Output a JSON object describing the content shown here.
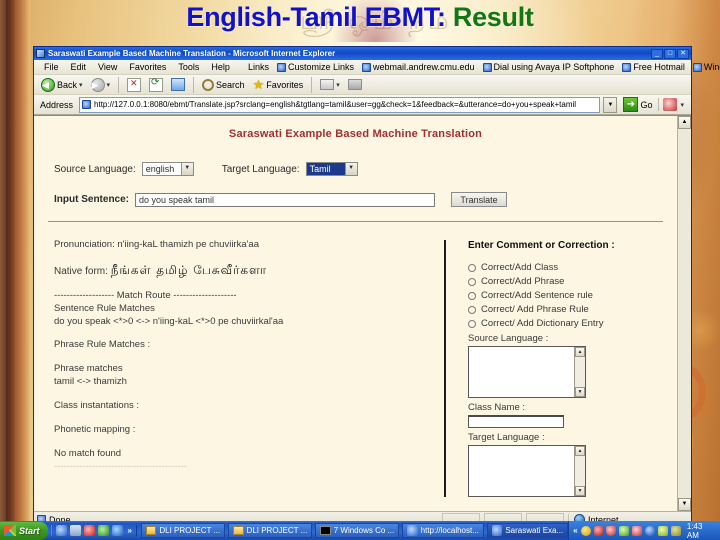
{
  "slide": {
    "title_part1": "English-Tamil EBMT:",
    "title_part2": "Result",
    "title_color_1": "#1111cc",
    "title_color_2": "#117711"
  },
  "browser": {
    "window_title": "Saraswati Example Based Machine Translation - Microsoft Internet Explorer",
    "window_buttons": {
      "minimize": "_",
      "maximize": "□",
      "close": "✕"
    },
    "menu": [
      "File",
      "Edit",
      "View",
      "Favorites",
      "Tools",
      "Help"
    ],
    "links_label": "Links",
    "links": [
      "Customize Links",
      "webmail.andrew.cmu.edu",
      "Dial using Avaya IP Softphone",
      "Free Hotmail",
      "Windows"
    ],
    "chevron": "»",
    "toolbar": {
      "back": "Back",
      "forward": "",
      "stop": "",
      "refresh": "",
      "home": "",
      "search": "Search",
      "favorites": "Favorites"
    },
    "address_label": "Address",
    "address_value": "http://127.0.0.1:8080/ebmt/Translate.jsp?srclang=english&tgtlang=tamil&user=gg&check=1&feedback=&utterance=do+you+speak+tamil",
    "go_label": "Go",
    "links_button_label": "Links",
    "status_text": "Done",
    "status_zone": "Internet"
  },
  "page": {
    "heading": "Saraswati Example Based Machine Translation",
    "source_language_label": "Source Language:",
    "source_language_value": "english",
    "target_language_label": "Target Language:",
    "target_language_value": "Tamil",
    "input_sentence_label": "Input Sentence:",
    "input_sentence_value": "do you speak tamil",
    "translate_button": "Translate",
    "results": {
      "pronunciation_label": "Pronunciation:",
      "pronunciation_value": "n'iing-kaL thamizh pe chuviirka'aa",
      "native_form_label": "Native form:",
      "native_form_value": "நீங்கள்  தமிழ்  பேசுவீர்களா",
      "match_route_header": "------------------- Match Route --------------------",
      "sentence_rule_matches_label": "Sentence Rule Matches",
      "sentence_rule_matches_value": "do you speak <*>0 <-> n'iing-kaL <*>0 pe chuviirkal'aa",
      "phrase_rule_matches_label": "Phrase Rule Matches :",
      "phrase_matches_label": "Phrase matches",
      "phrase_matches_value": "tamil <-> thamizh",
      "class_instantations_label": "Class instantations :",
      "phonetic_mapping_label": "Phonetic mapping :",
      "no_match_found": "No match found",
      "faded_line": "------------------------------------------"
    },
    "comment_panel": {
      "heading": "Enter Comment or Correction :",
      "options": [
        "Correct/Add Class",
        "Correct/Add Phrase",
        "Correct/Add Sentence rule",
        "Correct/ Add Phrase Rule",
        "Correct/ Add Dictionary Entry"
      ],
      "source_language_label": "Source Language :",
      "source_language_value": "",
      "class_name_label": "Class Name :",
      "class_name_value": "",
      "target_language_label": "Target Language :",
      "target_language_value": "",
      "scroll_up": "▲",
      "scroll_down": "▼"
    }
  },
  "taskbar": {
    "start_label": "Start",
    "quicklaunch_chevron": "»",
    "tasks": [
      {
        "label": "DLI PROJECT ...",
        "icon": "folder-icon"
      },
      {
        "label": "DLI PROJECT ...",
        "icon": "folder-icon"
      },
      {
        "label": "7 Windows Co ...",
        "icon": "command-prompt-icon"
      },
      {
        "label": "http://localhost...",
        "icon": "ie-icon"
      },
      {
        "label": "Saraswati Exa...",
        "icon": "ie-icon"
      }
    ],
    "tray_chevron": "«",
    "clock": "1:43 AM"
  }
}
